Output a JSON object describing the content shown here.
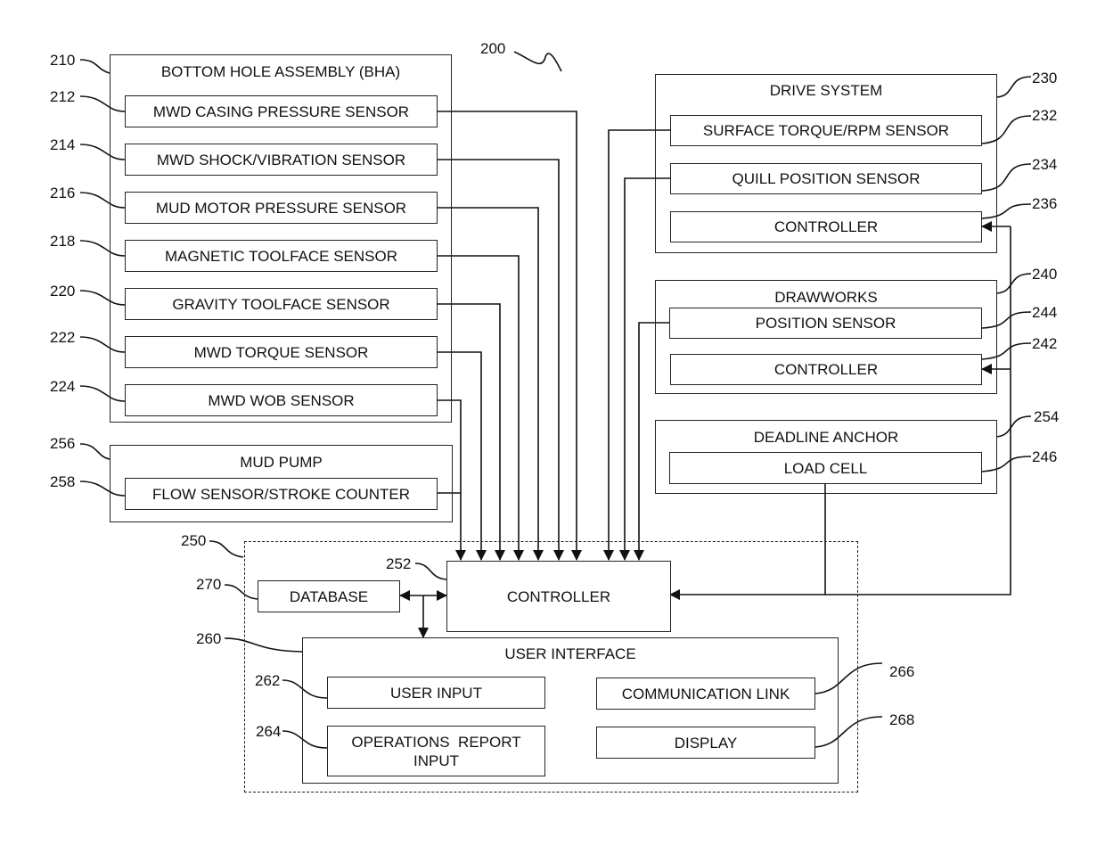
{
  "figure": {
    "ref": "200",
    "bha": {
      "ref": "210",
      "title": "BOTTOM HOLE ASSEMBLY (BHA)",
      "sensors": [
        {
          "ref": "212",
          "label": "MWD CASING PRESSURE SENSOR"
        },
        {
          "ref": "214",
          "label": "MWD SHOCK/VIBRATION SENSOR"
        },
        {
          "ref": "216",
          "label": "MUD MOTOR PRESSURE SENSOR"
        },
        {
          "ref": "218",
          "label": "MAGNETIC TOOLFACE SENSOR"
        },
        {
          "ref": "220",
          "label": "GRAVITY TOOLFACE SENSOR"
        },
        {
          "ref": "222",
          "label": "MWD TORQUE SENSOR"
        },
        {
          "ref": "224",
          "label": "MWD WOB SENSOR"
        }
      ]
    },
    "mud_pump": {
      "ref": "256",
      "title": "MUD PUMP",
      "sensor": {
        "ref": "258",
        "label": "FLOW SENSOR/STROKE COUNTER"
      }
    },
    "drive_system": {
      "ref": "230",
      "title": "DRIVE SYSTEM",
      "items": [
        {
          "ref": "232",
          "label": "SURFACE TORQUE/RPM SENSOR"
        },
        {
          "ref": "234",
          "label": "QUILL POSITION SENSOR"
        },
        {
          "ref": "236",
          "label": "CONTROLLER"
        }
      ]
    },
    "drawworks": {
      "ref": "240",
      "title": "DRAWWORKS",
      "items": [
        {
          "ref": "244",
          "label": "POSITION SENSOR"
        },
        {
          "ref": "242",
          "label": "CONTROLLER"
        }
      ]
    },
    "deadline_anchor": {
      "ref": "254",
      "title": "DEADLINE ANCHOR",
      "item": {
        "ref": "246",
        "label": "LOAD CELL"
      }
    },
    "control_system": {
      "ref": "250",
      "controller": {
        "ref": "252",
        "label": "CONTROLLER"
      },
      "database": {
        "ref": "270",
        "label": "DATABASE"
      },
      "user_interface": {
        "ref": "260",
        "title": "USER INTERFACE",
        "items": [
          {
            "ref": "262",
            "label": "USER INPUT"
          },
          {
            "ref": "264",
            "label_line1": "OPERATIONS  REPORT",
            "label_line2": "INPUT"
          },
          {
            "ref": "266",
            "label": "COMMUNICATION LINK"
          },
          {
            "ref": "268",
            "label": "DISPLAY"
          }
        ]
      }
    }
  }
}
